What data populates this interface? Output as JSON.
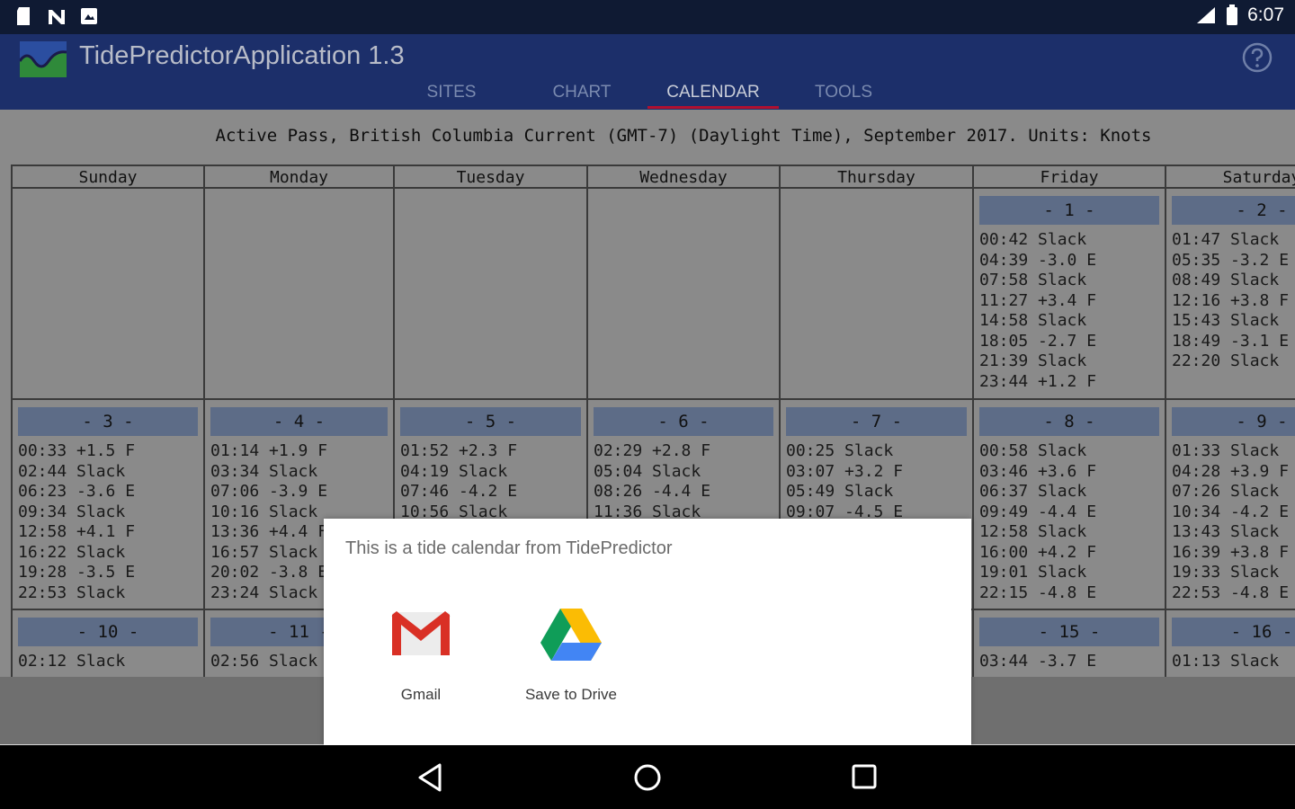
{
  "status_bar": {
    "time": "6:07"
  },
  "app": {
    "title": "TidePredictorApplication 1.3"
  },
  "tabs": [
    {
      "label": "SITES",
      "active": false
    },
    {
      "label": "CHART",
      "active": false
    },
    {
      "label": "CALENDAR",
      "active": true
    },
    {
      "label": "TOOLS",
      "active": false
    }
  ],
  "calendar": {
    "header": "Active Pass, British Columbia Current (GMT-7) (Daylight Time), September 2017. Units: Knots",
    "weekdays": [
      "Sunday",
      "Monday",
      "Tuesday",
      "Wednesday",
      "Thursday",
      "Friday",
      "Saturday"
    ],
    "weeks": [
      [
        null,
        null,
        null,
        null,
        null,
        {
          "day": "- 1 -",
          "events": [
            "00:42 Slack",
            "04:39 -3.0 E",
            "07:58 Slack",
            "11:27 +3.4 F",
            "14:58 Slack",
            "18:05 -2.7 E",
            "21:39 Slack",
            "23:44 +1.2 F"
          ]
        },
        {
          "day": "- 2 -",
          "events": [
            "01:47 Slack",
            "05:35 -3.2 E",
            "08:49 Slack",
            "12:16 +3.8 F",
            "15:43 Slack",
            "18:49 -3.1 E",
            "22:20 Slack"
          ]
        }
      ],
      [
        {
          "day": "- 3 -",
          "events": [
            "00:33 +1.5 F",
            "02:44 Slack",
            "06:23 -3.6 E",
            "09:34 Slack",
            "12:58 +4.1 F",
            "16:22 Slack",
            "19:28 -3.5 E",
            "22:53 Slack"
          ]
        },
        {
          "day": "- 4 -",
          "events": [
            "01:14 +1.9 F",
            "03:34 Slack",
            "07:06 -3.9 E",
            "10:16 Slack",
            "13:36 +4.4 F",
            "16:57 Slack",
            "20:02 -3.8 E",
            "23:24 Slack"
          ]
        },
        {
          "day": "- 5 -",
          "events": [
            "01:52 +2.3 F",
            "04:19 Slack",
            "07:46 -4.2 E",
            "10:56 Slack"
          ]
        },
        {
          "day": "- 6 -",
          "events": [
            "02:29 +2.8 F",
            "05:04 Slack",
            "08:26 -4.4 E",
            "11:36 Slack"
          ]
        },
        {
          "day": "- 7 -",
          "events": [
            "00:25 Slack",
            "03:07 +3.2 F",
            "05:49 Slack",
            "09:07 -4.5 E"
          ]
        },
        {
          "day": "- 8 -",
          "events": [
            "00:58 Slack",
            "03:46 +3.6 F",
            "06:37 Slack",
            "09:49 -4.4 E",
            "12:58 Slack",
            "16:00 +4.2 F",
            "19:01 Slack",
            "22:15 -4.8 E"
          ]
        },
        {
          "day": "- 9 -",
          "events": [
            "01:33 Slack",
            "04:28 +3.9 F",
            "07:26 Slack",
            "10:34 -4.2 E",
            "13:43 Slack",
            "16:39 +3.8 F",
            "19:33 Slack",
            "22:53 -4.8 E"
          ]
        }
      ],
      [
        {
          "day": "- 10 -",
          "events": [
            "02:12 Slack"
          ]
        },
        {
          "day": "- 11 -",
          "events": [
            "02:56 Slack"
          ]
        },
        null,
        null,
        null,
        {
          "day": "- 15 -",
          "events": [
            "03:44 -3.7 E"
          ]
        },
        {
          "day": "- 16 -",
          "events": [
            "01:13 Slack"
          ]
        }
      ]
    ]
  },
  "share_dialog": {
    "title": "This is a tide calendar from TidePredictor",
    "targets": [
      {
        "label": "Gmail",
        "icon": "gmail-icon"
      },
      {
        "label": "Save to Drive",
        "icon": "drive-icon"
      }
    ]
  },
  "nav": {
    "back": "back-icon",
    "home": "home-icon",
    "recents": "recents-icon"
  }
}
